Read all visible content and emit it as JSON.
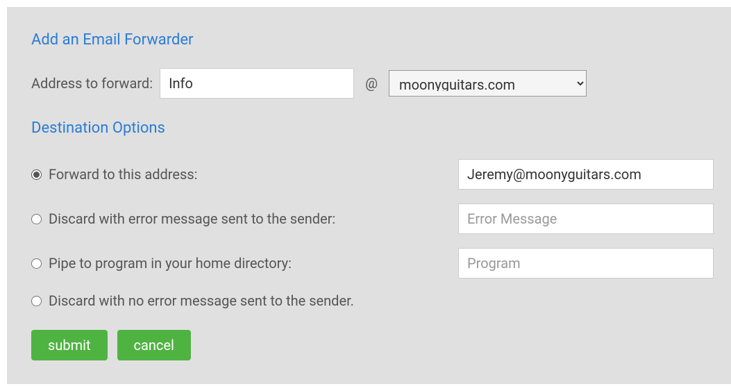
{
  "section_title": "Add an Email Forwarder",
  "address_label": "Address to forward:",
  "address_value": "Info",
  "at_symbol": "@",
  "domain_selected": "moonyguitars.com",
  "destination_title": "Destination Options",
  "options": {
    "forward": {
      "label": "Forward to this address:",
      "value": "Jeremy@moonyguitars.com"
    },
    "discard_error": {
      "label": "Discard with error message sent to the sender:",
      "placeholder": "Error Message"
    },
    "pipe": {
      "label": "Pipe to program in your home directory:",
      "placeholder": "Program"
    },
    "discard_silent": {
      "label": "Discard with no error message sent to the sender."
    }
  },
  "buttons": {
    "submit": "submit",
    "cancel": "cancel"
  }
}
